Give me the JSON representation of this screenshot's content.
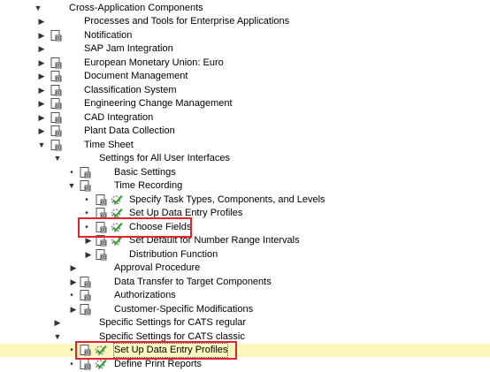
{
  "tree": {
    "root": {
      "label": "Cross-Application Components"
    },
    "items": [
      {
        "label": "Processes and Tools for Enterprise Applications",
        "state": "collapsed",
        "doc": false
      },
      {
        "label": "Notification",
        "state": "collapsed",
        "doc": true
      },
      {
        "label": "SAP Jam Integration",
        "state": "collapsed",
        "doc": false
      },
      {
        "label": "European Monetary Union: Euro",
        "state": "collapsed",
        "doc": true
      },
      {
        "label": "Document Management",
        "state": "collapsed",
        "doc": true
      },
      {
        "label": "Classification System",
        "state": "collapsed",
        "doc": true
      },
      {
        "label": "Engineering Change Management",
        "state": "collapsed",
        "doc": true
      },
      {
        "label": "CAD Integration",
        "state": "collapsed",
        "doc": true
      },
      {
        "label": "Plant Data Collection",
        "state": "collapsed",
        "doc": true
      },
      {
        "label": "Time Sheet",
        "state": "expanded",
        "doc": true
      },
      {
        "label": "Settings for All User Interfaces",
        "state": "expanded",
        "doc": false
      },
      {
        "label": "Basic Settings",
        "state": "leaf",
        "doc": true
      },
      {
        "label": "Time Recording",
        "state": "expanded",
        "doc": true
      },
      {
        "label": "Specify Task Types, Components, and Levels",
        "state": "leaf",
        "doc": true,
        "exec": true
      },
      {
        "label": "Set Up Data Entry Profiles",
        "state": "leaf",
        "doc": true,
        "exec": true
      },
      {
        "label": "Choose Fields",
        "state": "leaf",
        "doc": true,
        "exec": true
      },
      {
        "label": "Set Default for Number Range Intervals",
        "state": "leaf",
        "doc": true,
        "exec": true
      },
      {
        "label": "Distribution Function",
        "state": "collapsed",
        "doc": true
      },
      {
        "label": "Approval Procedure",
        "state": "collapsed",
        "doc": false
      },
      {
        "label": "Data Transfer to Target Components",
        "state": "collapsed",
        "doc": true
      },
      {
        "label": "Authorizations",
        "state": "leaf",
        "doc": true
      },
      {
        "label": "Customer-Specific Modifications",
        "state": "collapsed",
        "doc": true
      },
      {
        "label": "Specific Settings for CATS regular",
        "state": "collapsed",
        "doc": false
      },
      {
        "label": "Specific Settings for CATS classic",
        "state": "expanded",
        "doc": false
      },
      {
        "label": "Set Up Data Entry Profiles",
        "state": "leaf",
        "doc": true,
        "exec": true
      },
      {
        "label": "Define Print Reports",
        "state": "leaf",
        "doc": true,
        "exec": true
      }
    ]
  },
  "colors": {
    "highlight_row": "#fbf7bd",
    "annotation_box": "#e0262c",
    "execute_icon": "#2f9a2f"
  }
}
